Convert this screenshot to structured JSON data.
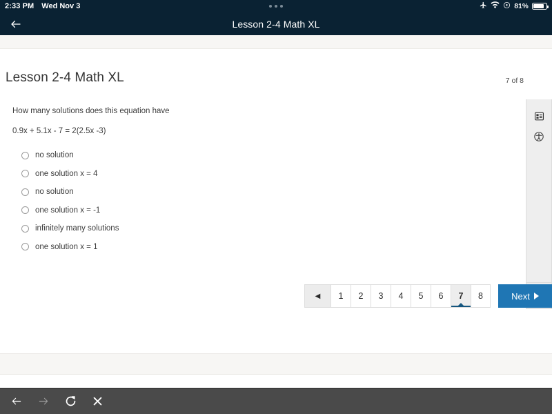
{
  "statusbar": {
    "time": "2:33 PM",
    "date": "Wed Nov 3",
    "battery_percent": "81%",
    "icons": [
      "airplane-mode-icon",
      "wifi-icon",
      "rotation-lock-icon",
      "battery-icon"
    ]
  },
  "appbar": {
    "back_label": "←",
    "title": "Lesson 2-4 Math XL"
  },
  "page": {
    "title": "Lesson 2-4 Math XL",
    "counter": "7 of 8",
    "question": "How many solutions does this equation have",
    "equation": "0.9x + 5.1x - 7 = 2(2.5x -3)",
    "choices": [
      {
        "label": "no solution",
        "selected": false
      },
      {
        "label": "one solution x = 4",
        "selected": false
      },
      {
        "label": "no solution",
        "selected": false
      },
      {
        "label": "one solution x = -1",
        "selected": false
      },
      {
        "label": "infinitely many solutions",
        "selected": false
      },
      {
        "label": "one solution x = 1",
        "selected": false
      }
    ]
  },
  "rail": {
    "items": [
      "contents-icon",
      "accessibility-icon"
    ],
    "collapse_label": "‹"
  },
  "pager": {
    "prev_label": "◀",
    "pages": [
      "1",
      "2",
      "3",
      "4",
      "5",
      "6",
      "7",
      "8"
    ],
    "active_page": "7",
    "next_label": "Next"
  },
  "browserbar": {
    "buttons": [
      "back-icon",
      "forward-icon",
      "reload-icon",
      "close-icon"
    ]
  },
  "colors": {
    "header_bg": "#0a2233",
    "accent_blue": "#1f76b4",
    "active_underline": "#15567f",
    "rail_bg": "#eeeeee",
    "browserbar_bg": "#4a4a4a"
  }
}
